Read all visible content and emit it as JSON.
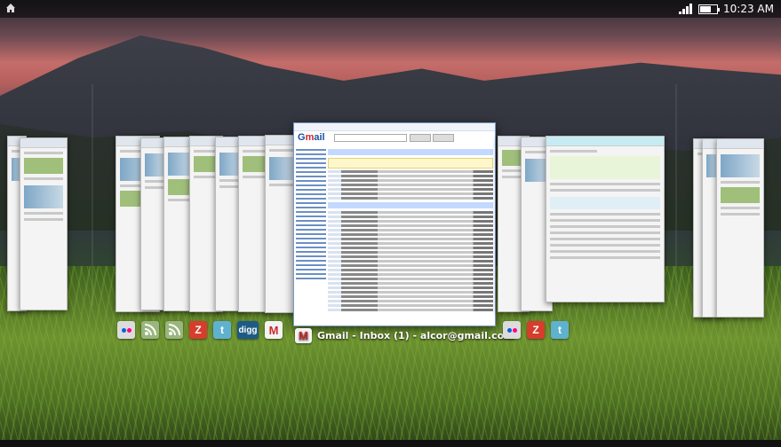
{
  "status_bar": {
    "time": "10:23 AM",
    "icons": [
      "home-icon",
      "signal-icon",
      "battery-icon"
    ]
  },
  "selected_window": {
    "title": "Gmail - Inbox (1) - alcor@gmail.com",
    "icon": "gmail-icon"
  },
  "left_group_icons": [
    "flickr-icon",
    "rss-icon",
    "rss-icon",
    "z-icon",
    "twitter-icon",
    "digg-icon",
    "gmail-icon"
  ],
  "right_group_icons": [
    "flickr-icon",
    "z-icon",
    "twitter-icon"
  ],
  "icon_labels": {
    "z": "Z",
    "twitter": "t",
    "digg": "digg",
    "gmail": "M"
  },
  "colors": {
    "gmail_red": "#cc2b2b",
    "twitter_blue": "#5fb2cf",
    "z_red": "#d63d2c"
  }
}
